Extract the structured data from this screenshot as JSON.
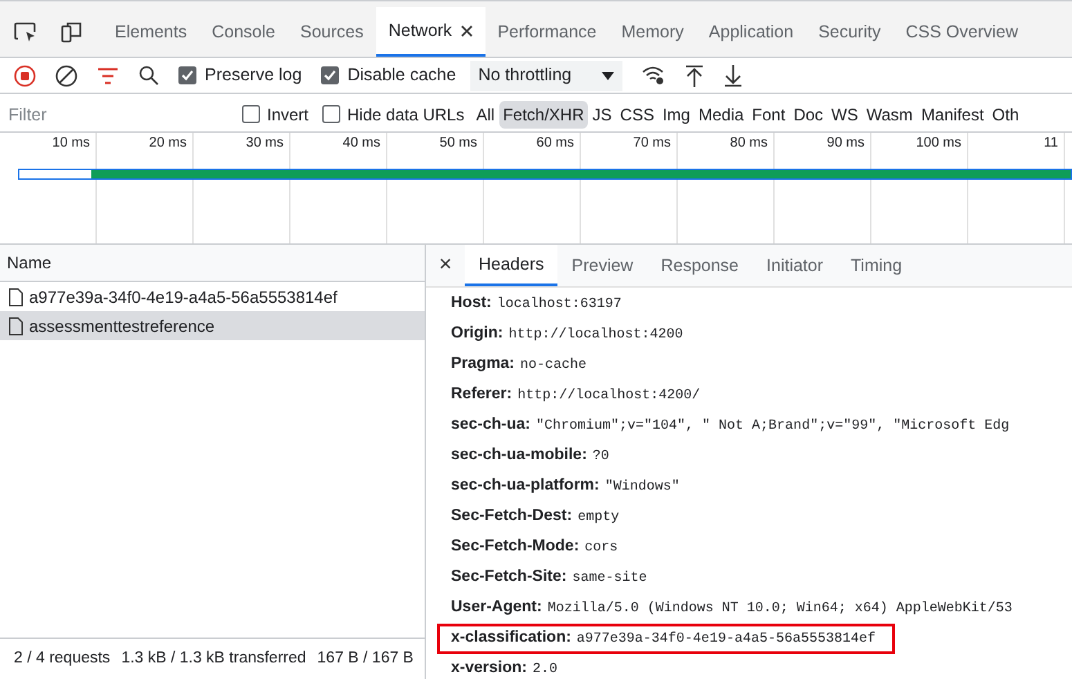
{
  "tabs": [
    {
      "label": "Elements",
      "selected": false,
      "closable": false
    },
    {
      "label": "Console",
      "selected": false,
      "closable": false
    },
    {
      "label": "Sources",
      "selected": false,
      "closable": false
    },
    {
      "label": "Network",
      "selected": true,
      "closable": true
    },
    {
      "label": "Performance",
      "selected": false,
      "closable": false
    },
    {
      "label": "Memory",
      "selected": false,
      "closable": false
    },
    {
      "label": "Application",
      "selected": false,
      "closable": false
    },
    {
      "label": "Security",
      "selected": false,
      "closable": false
    },
    {
      "label": "CSS Overview",
      "selected": false,
      "closable": false
    }
  ],
  "toolbar": {
    "recording": true,
    "checkboxes": [
      {
        "label": "Preserve log",
        "checked": true
      },
      {
        "label": "Disable cache",
        "checked": true
      }
    ],
    "throttling": "No throttling"
  },
  "filter_bar": {
    "placeholder": "Filter",
    "checkboxes": [
      {
        "label": "Invert",
        "checked": false
      },
      {
        "label": "Hide data URLs",
        "checked": false
      }
    ],
    "types": [
      {
        "label": "All",
        "selected": false
      },
      {
        "label": "Fetch/XHR",
        "selected": true
      },
      {
        "label": "JS",
        "selected": false
      },
      {
        "label": "CSS",
        "selected": false
      },
      {
        "label": "Img",
        "selected": false
      },
      {
        "label": "Media",
        "selected": false
      },
      {
        "label": "Font",
        "selected": false
      },
      {
        "label": "Doc",
        "selected": false
      },
      {
        "label": "WS",
        "selected": false
      },
      {
        "label": "Wasm",
        "selected": false
      },
      {
        "label": "Manifest",
        "selected": false
      },
      {
        "label": "Oth",
        "selected": false
      }
    ]
  },
  "timeline": {
    "ticks": [
      "10 ms",
      "20 ms",
      "30 ms",
      "40 ms",
      "50 ms",
      "60 ms",
      "70 ms",
      "80 ms",
      "90 ms",
      "100 ms",
      "11"
    ]
  },
  "requests": {
    "column": "Name",
    "rows": [
      {
        "name": "a977e39a-34f0-4e19-a4a5-56a5553814ef",
        "selected": false
      },
      {
        "name": "assessmenttestreference",
        "selected": true
      }
    ]
  },
  "status_bar": [
    "2 / 4 requests",
    "1.3 kB / 1.3 kB transferred",
    "167 B / 167 B"
  ],
  "details": {
    "close": "×",
    "tabs": [
      {
        "label": "Headers",
        "selected": true
      },
      {
        "label": "Preview",
        "selected": false
      },
      {
        "label": "Response",
        "selected": false
      },
      {
        "label": "Initiator",
        "selected": false
      },
      {
        "label": "Timing",
        "selected": false
      }
    ],
    "headers": [
      {
        "name": "Host:",
        "value": "localhost:63197",
        "highlighted": false
      },
      {
        "name": "Origin:",
        "value": "http://localhost:4200",
        "highlighted": false
      },
      {
        "name": "Pragma:",
        "value": "no-cache",
        "highlighted": false
      },
      {
        "name": "Referer:",
        "value": "http://localhost:4200/",
        "highlighted": false
      },
      {
        "name": "sec-ch-ua:",
        "value": "\"Chromium\";v=\"104\", \" Not A;Brand\";v=\"99\", \"Microsoft Edg",
        "highlighted": false
      },
      {
        "name": "sec-ch-ua-mobile:",
        "value": "?0",
        "highlighted": false
      },
      {
        "name": "sec-ch-ua-platform:",
        "value": "\"Windows\"",
        "highlighted": false
      },
      {
        "name": "Sec-Fetch-Dest:",
        "value": "empty",
        "highlighted": false
      },
      {
        "name": "Sec-Fetch-Mode:",
        "value": "cors",
        "highlighted": false
      },
      {
        "name": "Sec-Fetch-Site:",
        "value": "same-site",
        "highlighted": false
      },
      {
        "name": "User-Agent:",
        "value": "Mozilla/5.0 (Windows NT 10.0; Win64; x64) AppleWebKit/53",
        "highlighted": false
      },
      {
        "name": "x-classification:",
        "value": "a977e39a-34f0-4e19-a4a5-56a5553814ef",
        "highlighted": true
      },
      {
        "name": "x-version:",
        "value": "2.0",
        "highlighted": false
      }
    ]
  }
}
